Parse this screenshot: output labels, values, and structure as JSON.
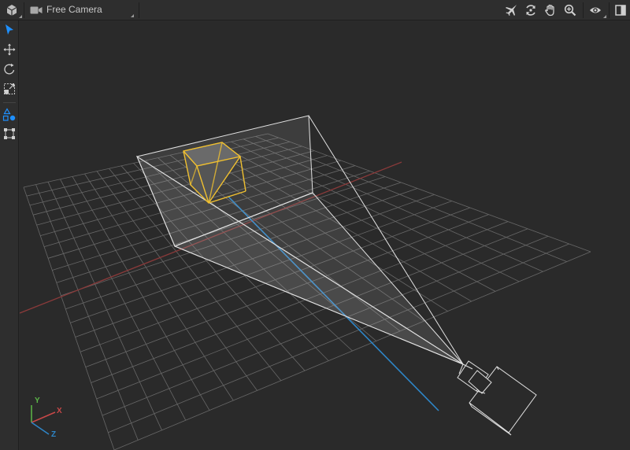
{
  "toolbar": {
    "app_icon": "cube-icon",
    "camera_icon": "video-camera-icon",
    "camera_label": "Free Camera",
    "right_icons": [
      "fly-icon",
      "orbit-icon",
      "pan-hand-icon",
      "zoom-icon",
      "eye-icon",
      "panel-toggle-icon"
    ]
  },
  "tools": [
    {
      "name": "select-tool",
      "icon": "cursor-arrow-icon",
      "active": true
    },
    {
      "name": "move-tool",
      "icon": "move-arrows-icon"
    },
    {
      "name": "rotate-tool",
      "icon": "rotate-icon"
    },
    {
      "name": "scale-tool",
      "icon": "scale-icon"
    },
    {
      "name": "shapes-tool",
      "icon": "shapes-icon"
    },
    {
      "name": "rect-transform-tool",
      "icon": "rect-transform-icon"
    }
  ],
  "gizmo": {
    "x_label": "X",
    "y_label": "Y",
    "z_label": "Z"
  },
  "colors": {
    "accent": "#1e90ff",
    "selection": "#f0c030",
    "axis_x": "#c84848",
    "axis_y": "#5cb848",
    "axis_z": "#2e86c8",
    "grid": "#8a8a8a"
  }
}
